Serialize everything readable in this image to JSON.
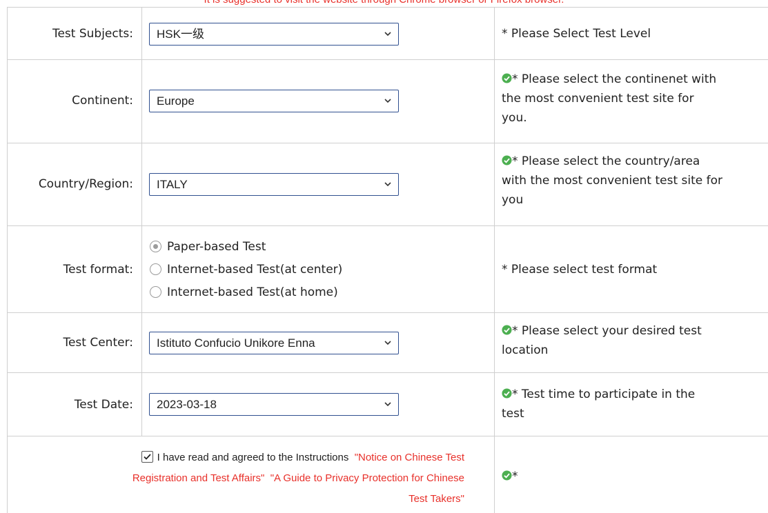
{
  "notice": "It is suggested to visit the website through Chrome browser or Firefox browser.",
  "rows": {
    "subject": {
      "label": "Test Subjects:",
      "value": "HSK一级",
      "hint": "* Please Select Test Level"
    },
    "continent": {
      "label": "Continent:",
      "value": "Europe",
      "hint_lines": [
        "* Please select the continenet with",
        "the most convenient test site for",
        "you."
      ]
    },
    "country": {
      "label": "Country/Region:",
      "value": "ITALY",
      "hint_lines": [
        "* Please select the country/area",
        "with the most convenient test site for",
        "you"
      ]
    },
    "format": {
      "label": "Test format:",
      "options": [
        "Paper-based Test",
        "Internet-based Test(at center)",
        "Internet-based Test(at home)"
      ],
      "selected": "Paper-based Test",
      "hint": "* Please select test format"
    },
    "center": {
      "label": "Test Center:",
      "value": "Istituto Confucio Unikore Enna",
      "hint_lines": [
        "* Please select your desired test",
        "location"
      ]
    },
    "date": {
      "label": "Test Date:",
      "value": "2023-03-18",
      "hint_lines": [
        "* Test time to participate in the",
        "test"
      ]
    }
  },
  "agreement": {
    "checked": true,
    "text": "I have read and agreed to the Instructions",
    "link1_part1": "\"Notice on Chinese Test",
    "link1_part2": "Registration and Test Affairs\"",
    "link2_part1": "\"A Guide to Privacy Protection for Chinese",
    "link2_part2": "Test Takers\"",
    "hint": "*"
  },
  "colors": {
    "notice_red": "#e8302a",
    "select_border": "#2f4f8f",
    "grid_line": "#cfcfcf",
    "check_green": "#4caf50"
  },
  "icons": {
    "dropdown": "chevron-down-icon",
    "valid": "check-circle-icon"
  }
}
